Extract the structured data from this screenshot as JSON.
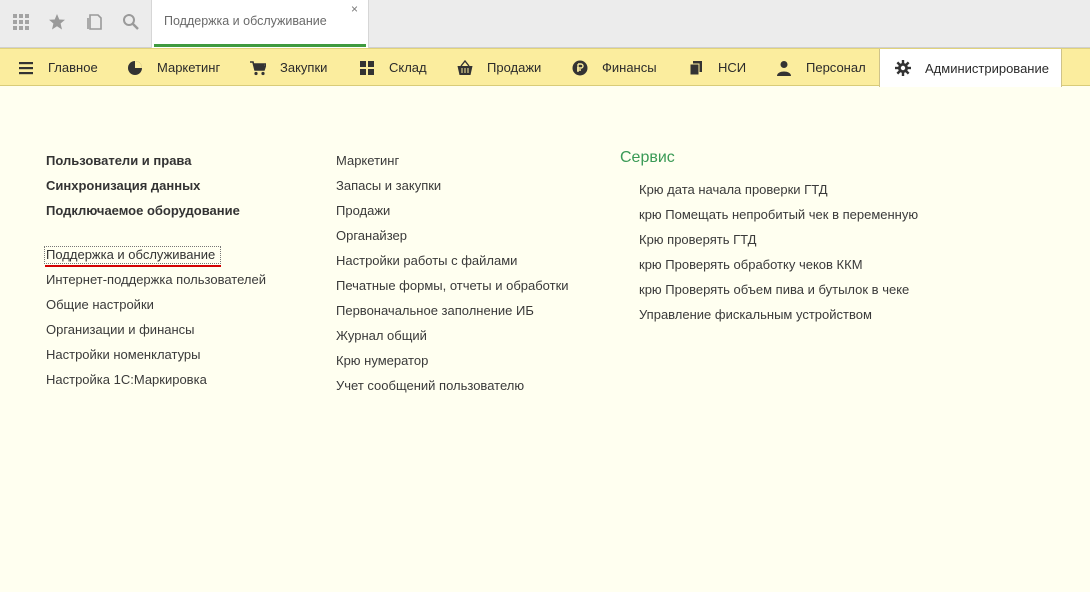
{
  "topbar": {
    "icons": [
      "apps-grid-icon",
      "star-icon",
      "history-icon",
      "search-icon"
    ],
    "tab": {
      "label": "Поддержка и обслуживание",
      "close": "×"
    },
    "accent_color": "#3f9a3f"
  },
  "sections": {
    "background": "#fbed9e",
    "items": [
      {
        "label": "Главное",
        "icon": "menu-icon"
      },
      {
        "label": "Маркетинг",
        "icon": "pie-chart-icon"
      },
      {
        "label": "Закупки",
        "icon": "cart-icon"
      },
      {
        "label": "Склад",
        "icon": "warehouse-grid-icon"
      },
      {
        "label": "Продажи",
        "icon": "basket-icon"
      },
      {
        "label": "Финансы",
        "icon": "ruble-coin-icon"
      },
      {
        "label": "НСИ",
        "icon": "documents-icon"
      },
      {
        "label": "Персонал",
        "icon": "person-icon"
      },
      {
        "label": "Администрирование",
        "icon": "gear-icon",
        "active": true
      }
    ]
  },
  "content": {
    "col1_bold": [
      "Пользователи и права",
      "Синхронизация данных",
      "Подключаемое оборудование"
    ],
    "col1_links": [
      "Поддержка и обслуживание",
      "Интернет-поддержка пользователей",
      "Общие настройки",
      "Организации и финансы",
      "Настройки номенклатуры",
      "Настройка 1С:Маркировка"
    ],
    "col2_links": [
      "Маркетинг",
      "Запасы и закупки",
      "Продажи",
      "Органайзер",
      "Настройки работы с файлами",
      "Печатные формы, отчеты и обработки",
      "Первоначальное заполнение ИБ",
      "Журнал общий",
      "Крю нумератор",
      "Учет сообщений пользователю"
    ],
    "service_title": "Сервис",
    "service_links": [
      "Крю дата начала проверки ГТД",
      "крю Помещать непробитый чек в переменную",
      "Крю проверять ГТД",
      "крю Проверять обработку чеков ККМ",
      "крю Проверять объем пива и бутылок в чеке",
      "Управление фискальным устройством"
    ],
    "highlight_color": "#d20000",
    "service_color": "#3a9a56"
  }
}
